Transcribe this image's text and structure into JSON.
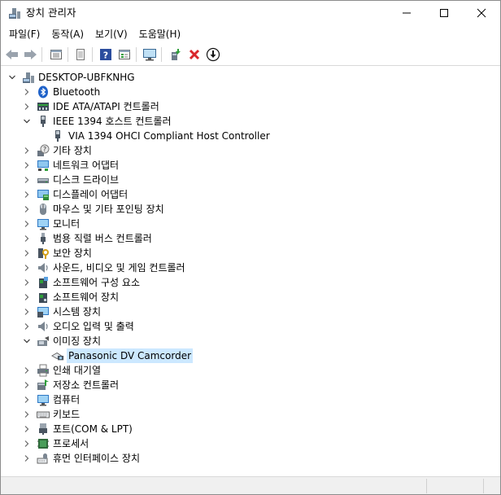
{
  "window": {
    "title": "장치 관리자",
    "controls": {
      "minimize": "minimize",
      "maximize": "maximize",
      "close": "close"
    }
  },
  "menu": {
    "items": [
      {
        "label": "파일(F)"
      },
      {
        "label": "동작(A)"
      },
      {
        "label": "보기(V)"
      },
      {
        "label": "도움말(H)"
      }
    ]
  },
  "toolbar": {
    "buttons": [
      "back-arrow-icon",
      "forward-arrow-icon",
      "properties-grid-icon",
      "page-icon",
      "help-icon",
      "view-icon",
      "monitor-icon",
      "update-driver-icon",
      "uninstall-x-icon",
      "download-icon"
    ],
    "colors": {
      "uninstall": "#d9262b",
      "help": "#2b4d9e",
      "update": "#2e9e3a"
    }
  },
  "tree": {
    "root": "DESKTOP-UBFKNHG",
    "items": [
      {
        "label": "Bluetooth",
        "icon": "bluetooth-icon",
        "expanded": false
      },
      {
        "label": "IDE ATA/ATAPI 컨트롤러",
        "icon": "ide-controller-icon",
        "expanded": false
      },
      {
        "label": "IEEE 1394 호스트 컨트롤러",
        "icon": "ieee1394-icon",
        "expanded": true,
        "children": [
          {
            "label": "VIA 1394 OHCI Compliant Host Controller",
            "icon": "ieee1394-device-icon"
          }
        ]
      },
      {
        "label": "기타 장치",
        "icon": "other-devices-icon",
        "expanded": false
      },
      {
        "label": "네트워크 어댑터",
        "icon": "network-adapter-icon",
        "expanded": false
      },
      {
        "label": "디스크 드라이브",
        "icon": "disk-drive-icon",
        "expanded": false
      },
      {
        "label": "디스플레이 어댑터",
        "icon": "display-adapter-icon",
        "expanded": false
      },
      {
        "label": "마우스 및 기타 포인팅 장치",
        "icon": "mouse-icon",
        "expanded": false
      },
      {
        "label": "모니터",
        "icon": "monitor-icon",
        "expanded": false
      },
      {
        "label": "범용 직렬 버스 컨트롤러",
        "icon": "usb-icon",
        "expanded": false
      },
      {
        "label": "보안 장치",
        "icon": "security-key-icon",
        "expanded": false
      },
      {
        "label": "사운드, 비디오 및 게임 컨트롤러",
        "icon": "speaker-icon",
        "expanded": false
      },
      {
        "label": "소프트웨어 구성 요소",
        "icon": "software-component-icon",
        "expanded": false
      },
      {
        "label": "소프트웨어 장치",
        "icon": "software-device-icon",
        "expanded": false
      },
      {
        "label": "시스템 장치",
        "icon": "system-device-icon",
        "expanded": false
      },
      {
        "label": "오디오 입력 및 출력",
        "icon": "audio-io-icon",
        "expanded": false
      },
      {
        "label": "이미징 장치",
        "icon": "imaging-device-icon",
        "expanded": true,
        "children": [
          {
            "label": "Panasonic DV Camcorder",
            "icon": "camcorder-icon",
            "selected": true
          }
        ]
      },
      {
        "label": "인쇄 대기열",
        "icon": "print-queue-icon",
        "expanded": false
      },
      {
        "label": "저장소 컨트롤러",
        "icon": "storage-controller-icon",
        "expanded": false
      },
      {
        "label": "컴퓨터",
        "icon": "computer-icon",
        "expanded": false
      },
      {
        "label": "키보드",
        "icon": "keyboard-icon",
        "expanded": false
      },
      {
        "label": "포트(COM & LPT)",
        "icon": "port-icon",
        "expanded": false
      },
      {
        "label": "프로세서",
        "icon": "processor-icon",
        "expanded": false
      },
      {
        "label": "휴먼 인터페이스 장치",
        "icon": "hid-icon",
        "expanded": false
      }
    ]
  },
  "selection_color": "#cce8ff"
}
